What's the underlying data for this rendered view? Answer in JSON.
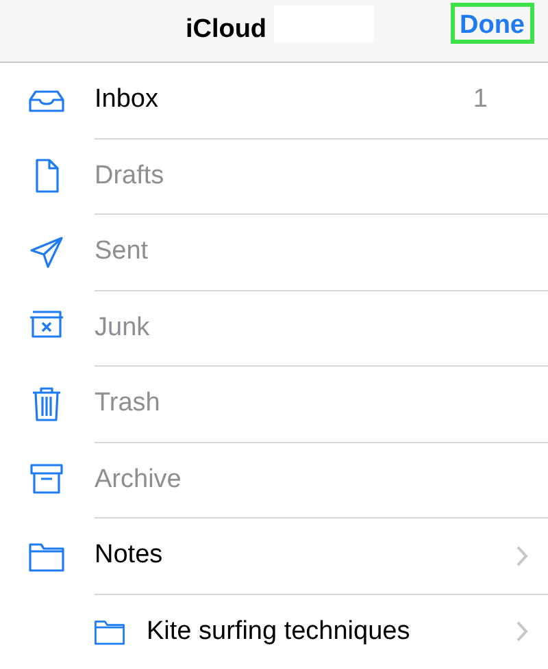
{
  "header": {
    "title": "iCloud",
    "done_button": {
      "label": "Done",
      "highlighted": true
    }
  },
  "mailboxes": [
    {
      "kind": "inbox",
      "label": "Inbox",
      "count": "1",
      "disabled": false,
      "chevron": false
    },
    {
      "kind": "drafts",
      "label": "Drafts",
      "disabled": true,
      "chevron": false
    },
    {
      "kind": "sent",
      "label": "Sent",
      "disabled": true,
      "chevron": false
    },
    {
      "kind": "junk",
      "label": "Junk",
      "disabled": true,
      "chevron": false
    },
    {
      "kind": "trash",
      "label": "Trash",
      "disabled": true,
      "chevron": false
    },
    {
      "kind": "archive",
      "label": "Archive",
      "disabled": true,
      "chevron": false
    },
    {
      "kind": "folder",
      "label": "Notes",
      "disabled": false,
      "chevron": true,
      "children": [
        {
          "kind": "folder",
          "label": "Kite surfing techniques",
          "disabled": false,
          "chevron": true
        }
      ]
    }
  ]
}
